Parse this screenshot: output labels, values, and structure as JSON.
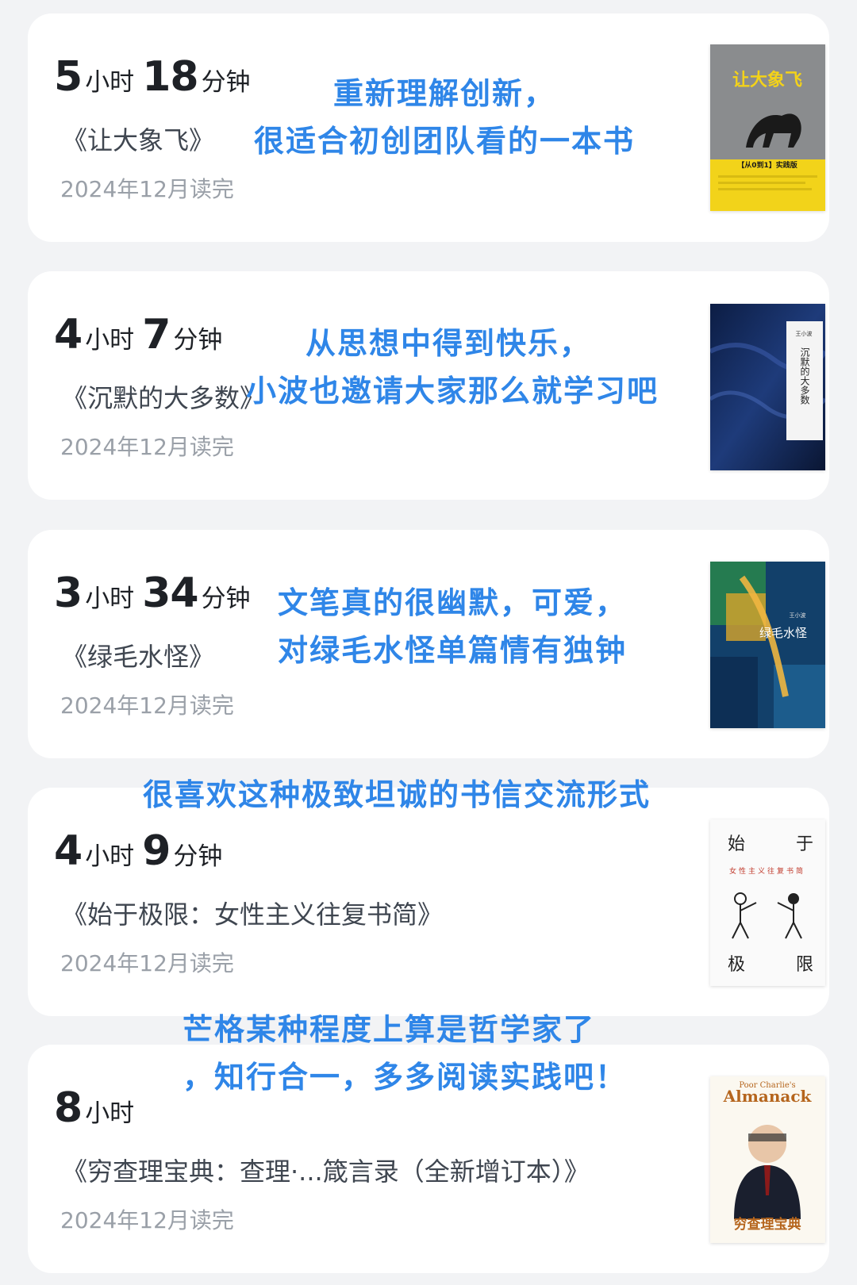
{
  "books": [
    {
      "hours": "5",
      "hours_unit": "小时",
      "minutes": "18",
      "minutes_unit": "分钟",
      "title": "《让大象飞》",
      "finished": "2024年12月读完",
      "note_lines": [
        "重新理解创新，",
        "很适合初创团队看的一本书"
      ],
      "cover_title": "让大象飞",
      "cover_badge": "【从0到1】实践版"
    },
    {
      "hours": "4",
      "hours_unit": "小时",
      "minutes": "7",
      "minutes_unit": "分钟",
      "title": "《沉默的大多数》",
      "finished": "2024年12月读完",
      "note_lines": [
        "从思想中得到快乐，",
        "小波也邀请大家那么就学习吧"
      ],
      "cover_title": "沉默的大多数",
      "cover_author": "王小波"
    },
    {
      "hours": "3",
      "hours_unit": "小时",
      "minutes": "34",
      "minutes_unit": "分钟",
      "title": "《绿毛水怪》",
      "finished": "2024年12月读完",
      "note_lines": [
        "文笔真的很幽默，可爱，",
        "对绿毛水怪单篇情有独钟"
      ],
      "cover_title": "绿毛水怪",
      "cover_author": "王小波"
    },
    {
      "hours": "4",
      "hours_unit": "小时",
      "minutes": "9",
      "minutes_unit": "分钟",
      "title": "《始于极限：女性主义往复书简》",
      "finished": "2024年12月读完",
      "note_lines": [
        "很喜欢这种极致坦诚的书信交流形式"
      ],
      "cover_chars": [
        "始",
        "于",
        "极",
        "限"
      ],
      "cover_subtitle": "女性主义往复书简"
    },
    {
      "hours": "8",
      "hours_unit": "小时",
      "minutes": "",
      "minutes_unit": "",
      "title": "《穷查理宝典：查理·...箴言录（全新增订本）》",
      "finished": "2024年12月读完",
      "note_lines": [
        "芒格某种程度上算是哲学家了",
        "，知行合一，多多阅读实践吧！"
      ],
      "cover_top": "Poor Charlie's",
      "cover_title_en": "Almanack",
      "cover_title": "穷查理宝典"
    }
  ],
  "colors": {
    "note": "#2f86e8",
    "card": "#ffffff",
    "background": "#f2f3f5"
  }
}
